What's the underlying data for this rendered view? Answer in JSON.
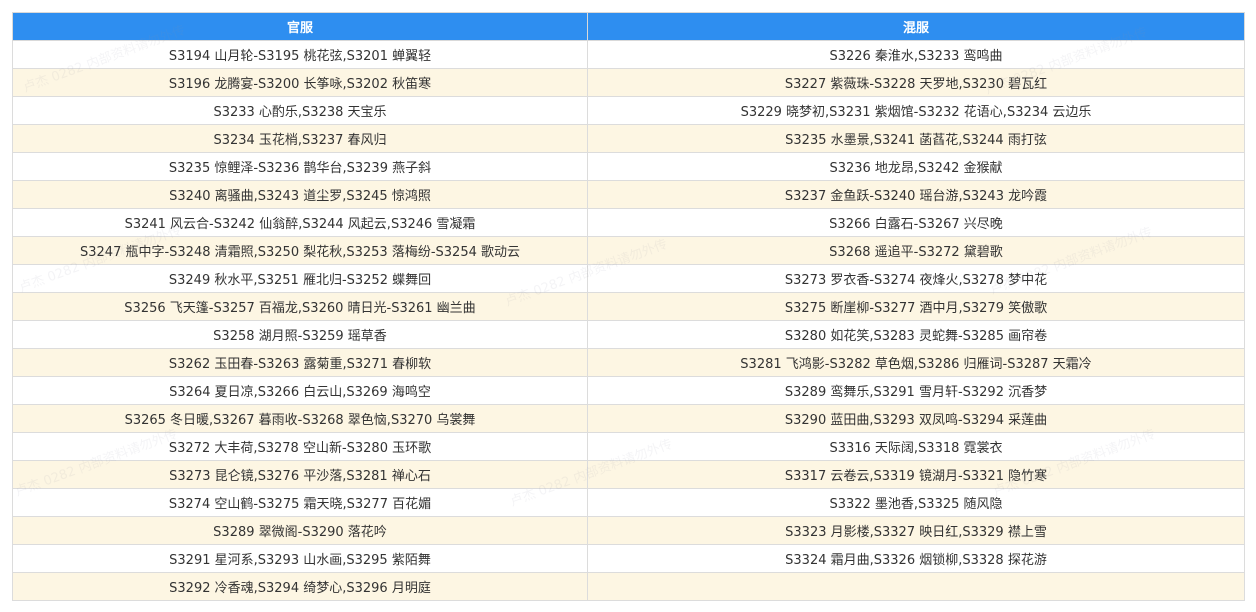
{
  "table": {
    "headers": [
      "官服",
      "混服"
    ],
    "rows": [
      [
        "S3194 山月轮-S3195 桃花弦,S3201 蝉翼轻",
        "S3226 秦淮水,S3233 鸾鸣曲"
      ],
      [
        "S3196 龙腾宴-S3200 长筝咏,S3202 秋笛寒",
        "S3227 紫薇珠-S3228 天罗地,S3230 碧瓦红"
      ],
      [
        "S3233 心酌乐,S3238 天宝乐",
        "S3229 晓梦初,S3231 紫烟馆-S3232 花语心,S3234 云边乐"
      ],
      [
        "S3234 玉花梢,S3237 春风归",
        "S3235 水墨景,S3241 菡萏花,S3244 雨打弦"
      ],
      [
        "S3235 惊鲤泽-S3236 鹊华台,S3239 燕子斜",
        "S3236 地龙昂,S3242 金猴献"
      ],
      [
        "S3240 离骚曲,S3243 道尘罗,S3245 惊鸿照",
        "S3237 金鱼跃-S3240 瑶台游,S3243 龙吟霞"
      ],
      [
        "S3241 风云合-S3242 仙翁醉,S3244 风起云,S3246 雪凝霜",
        "S3266 白露石-S3267 兴尽晚"
      ],
      [
        "S3247 瓶中字-S3248 清霜照,S3250 梨花秋,S3253 落梅纷-S3254 歌动云",
        "S3268 遥追平-S3272 黛碧歌"
      ],
      [
        "S3249 秋水平,S3251 雁北归-S3252 蝶舞回",
        "S3273 罗衣香-S3274 夜烽火,S3278 梦中花"
      ],
      [
        "S3256 飞天篷-S3257 百福龙,S3260 晴日光-S3261 幽兰曲",
        "S3275 断崖柳-S3277 酒中月,S3279 笑傲歌"
      ],
      [
        "S3258 湖月照-S3259 瑶草香",
        "S3280 如花笑,S3283 灵蛇舞-S3285 画帘卷"
      ],
      [
        "S3262 玉田春-S3263 露菊重,S3271 春柳软",
        "S3281 飞鸿影-S3282 草色烟,S3286 归雁词-S3287 天霜冷"
      ],
      [
        "S3264 夏日凉,S3266 白云山,S3269 海鸣空",
        "S3289 鸾舞乐,S3291 雪月轩-S3292 沉香梦"
      ],
      [
        "S3265 冬日暖,S3267 暮雨收-S3268 翠色恼,S3270 乌裳舞",
        "S3290 蓝田曲,S3293 双凤鸣-S3294 采莲曲"
      ],
      [
        "S3272 大丰荷,S3278 空山新-S3280 玉环歌",
        "S3316 天际阔,S3318 霓裳衣"
      ],
      [
        "S3273 昆仑镜,S3276 平沙落,S3281 禅心石",
        "S3317 云卷云,S3319 镜湖月-S3321 隐竹寒"
      ],
      [
        "S3274 空山鹤-S3275 霜天晓,S3277 百花媚",
        "S3322 墨池香,S3325 随风隐"
      ],
      [
        "S3289 翠微阁-S3290 落花吟",
        "S3323 月影楼,S3327 映日红,S3329 襟上雪"
      ],
      [
        "S3291 星河系,S3293 山水画,S3295 紫陌舞",
        "S3324 霜月曲,S3326 烟锁柳,S3328 探花游"
      ],
      [
        "S3292 冷香魂,S3294 绮梦心,S3296 月明庭",
        ""
      ]
    ]
  },
  "watermark": "卢杰 0282 内部资料请勿外传",
  "colors": {
    "header_bg": "#2e8ef0",
    "header_text": "#ffffff",
    "row_alt_bg": "#fdf6e3",
    "border": "#dcdcdc"
  }
}
